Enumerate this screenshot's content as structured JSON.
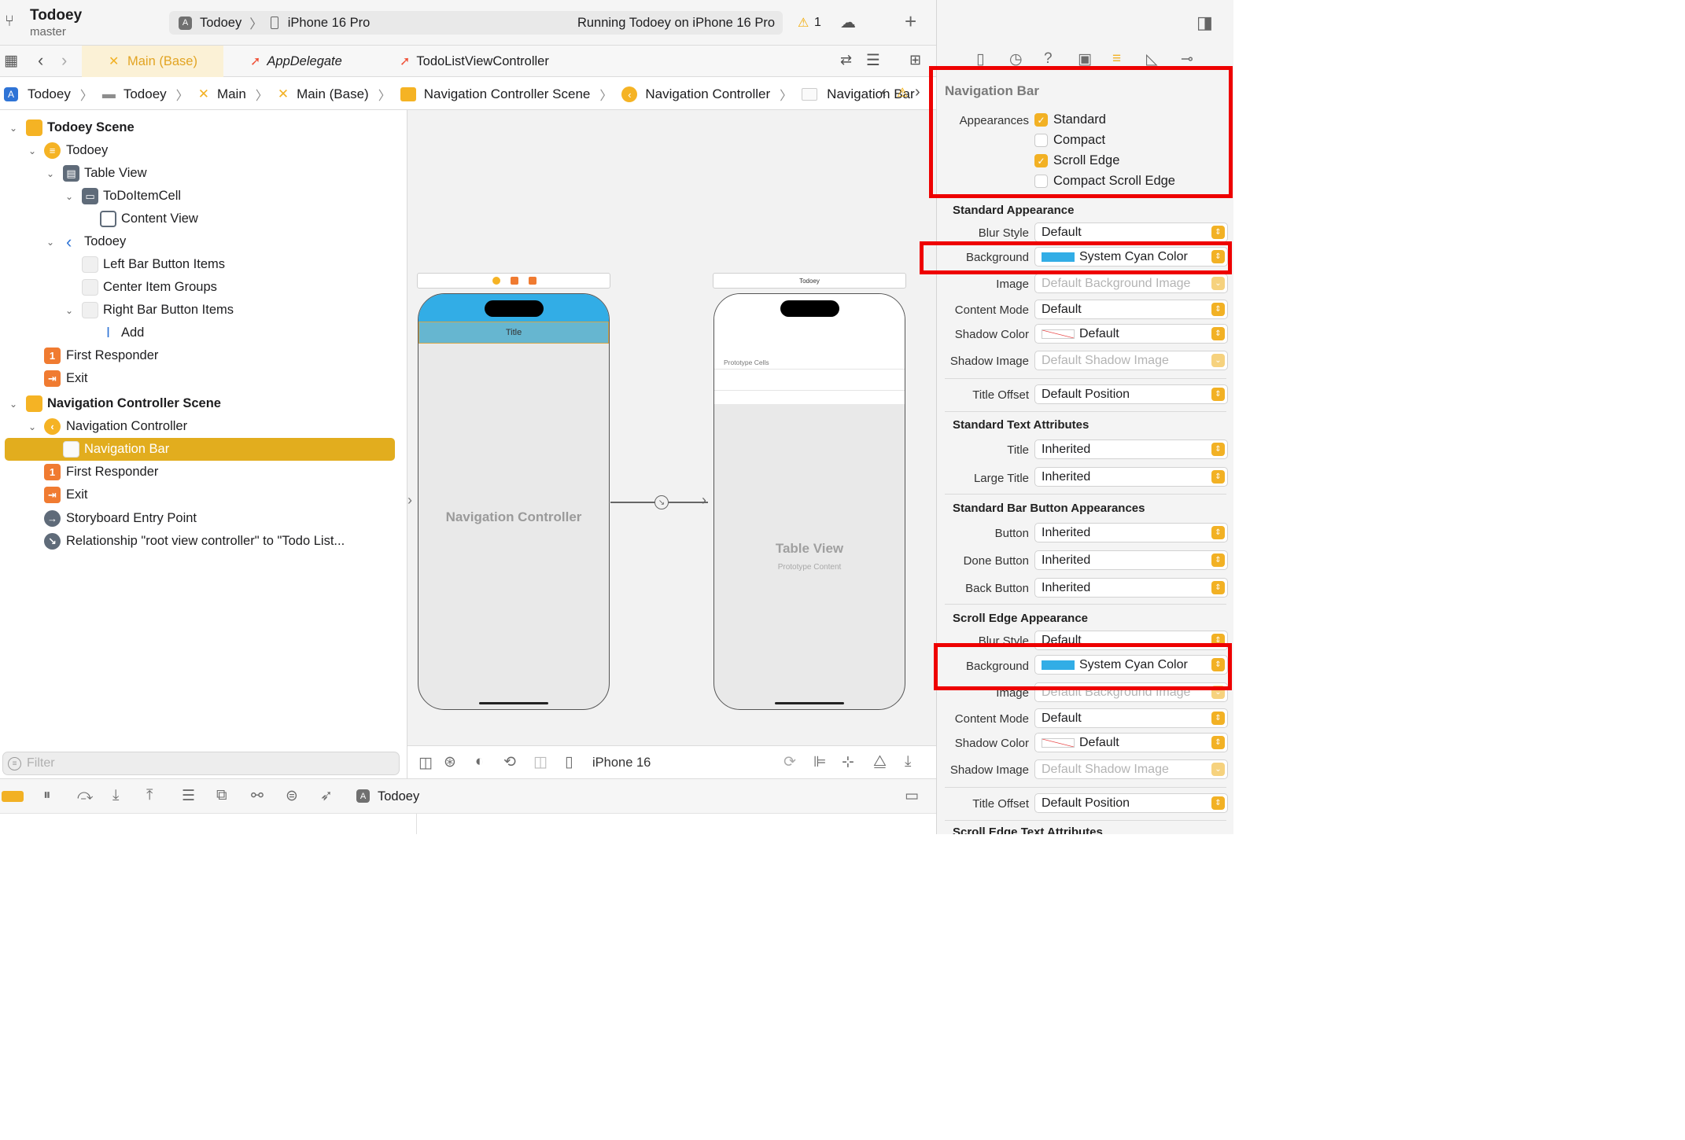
{
  "project": {
    "name": "Todoey",
    "branch": "master"
  },
  "scheme": {
    "target": "Todoey",
    "device": "iPhone 16 Pro",
    "status": "Running Todoey on iPhone 16 Pro",
    "warning_count": "1"
  },
  "tabs": [
    {
      "label": "Main (Base)"
    },
    {
      "label": "AppDelegate"
    },
    {
      "label": "TodoListViewController"
    }
  ],
  "breadcrumb": [
    "Todoey",
    "Todoey",
    "Main",
    "Main (Base)",
    "Navigation Controller Scene",
    "Navigation Controller",
    "Navigation Bar"
  ],
  "tree": {
    "todoey_scene": "Todoey Scene",
    "todoey": "Todoey",
    "table_view": "Table View",
    "cell": "ToDoItemCell",
    "content_view": "Content View",
    "nav_item": "Todoey",
    "left_items": "Left Bar Button Items",
    "center_groups": "Center Item Groups",
    "right_items": "Right Bar Button Items",
    "add": "Add",
    "first_responder": "First Responder",
    "exit": "Exit",
    "nav_scene": "Navigation Controller Scene",
    "nav_controller": "Navigation Controller",
    "nav_bar": "Navigation Bar",
    "first_responder2": "First Responder",
    "exit2": "Exit",
    "entry_point": "Storyboard Entry Point",
    "relationship": "Relationship \"root view controller\" to \"Todo List..."
  },
  "filter_placeholder": "Filter",
  "canvas": {
    "nav_title": "Title",
    "nav_controller_label": "Navigation Controller",
    "table_scene_title": "Todoey",
    "prototype_cells": "Prototype Cells",
    "table_view_label": "Table View",
    "prototype_content": "Prototype Content",
    "device": "iPhone 16"
  },
  "debug": {
    "target": "Todoey"
  },
  "inspector": {
    "section_title": "Navigation Bar",
    "appearances_label": "Appearances",
    "appearances": [
      {
        "label": "Standard",
        "checked": true
      },
      {
        "label": "Compact",
        "checked": false
      },
      {
        "label": "Scroll Edge",
        "checked": true
      },
      {
        "label": "Compact Scroll Edge",
        "checked": false
      }
    ],
    "standard_appearance": "Standard Appearance",
    "blur_style_label": "Blur Style",
    "blur_style": "Default",
    "background_label": "Background",
    "background": "System Cyan Color",
    "image_label": "Image",
    "image": "Default Background Image",
    "content_mode_label": "Content Mode",
    "content_mode": "Default",
    "shadow_color_label": "Shadow Color",
    "shadow_color": "Default",
    "shadow_image_label": "Shadow Image",
    "shadow_image": "Default Shadow Image",
    "title_offset_label": "Title Offset",
    "title_offset": "Default Position",
    "std_text_attrs": "Standard Text Attributes",
    "title_label": "Title",
    "title": "Inherited",
    "large_title_label": "Large Title",
    "large_title": "Inherited",
    "std_bar_button": "Standard Bar Button Appearances",
    "button_label": "Button",
    "button": "Inherited",
    "done_button_label": "Done Button",
    "done_button": "Inherited",
    "back_button_label": "Back Button",
    "back_button": "Inherited",
    "scroll_edge_appearance": "Scroll Edge Appearance",
    "se_blur_style_label": "Blur Style",
    "se_blur_style": "Default",
    "se_background_label": "Background",
    "se_background": "System Cyan Color",
    "se_image_label": "Image",
    "se_image": "Default Background Image",
    "se_content_mode_label": "Content Mode",
    "se_content_mode": "Default",
    "se_shadow_color_label": "Shadow Color",
    "se_shadow_color": "Default",
    "se_shadow_image_label": "Shadow Image",
    "se_shadow_image": "Default Shadow Image",
    "se_title_offset_label": "Title Offset",
    "se_title_offset": "Default Position",
    "se_text_attrs": "Scroll Edge Text Attributes"
  },
  "colors": {
    "accent": "#f2b124",
    "selection": "#e2ad1e",
    "cyan": "#32ade6",
    "highlight": "#ee0000"
  }
}
